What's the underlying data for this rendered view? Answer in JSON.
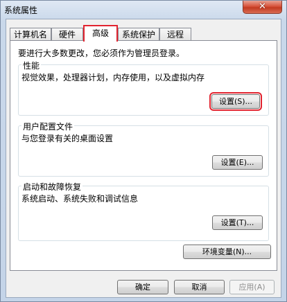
{
  "window": {
    "title": "系统属性",
    "close_glyph": "✕"
  },
  "tabs": [
    {
      "label": "计算机名"
    },
    {
      "label": "硬件"
    },
    {
      "label": "高级",
      "active": true
    },
    {
      "label": "系统保护"
    },
    {
      "label": "远程"
    }
  ],
  "panel": {
    "admin_note": "要进行大多数更改，您必须作为管理员登录。",
    "performance": {
      "title": "性能",
      "description": "视觉效果，处理器计划，内存使用，以及虚拟内存",
      "button": "设置(S)..."
    },
    "user_profiles": {
      "title": "用户配置文件",
      "description": "与您登录有关的桌面设置",
      "button": "设置(E)..."
    },
    "startup_recovery": {
      "title": "启动和故障恢复",
      "description": "系统启动、系统失败和调试信息",
      "button": "设置(T)..."
    },
    "env_button": "环境变量(N)..."
  },
  "footer": {
    "ok": "确定",
    "cancel": "取消",
    "apply": "应用(A)"
  },
  "colors": {
    "highlight": "#e2232f"
  }
}
